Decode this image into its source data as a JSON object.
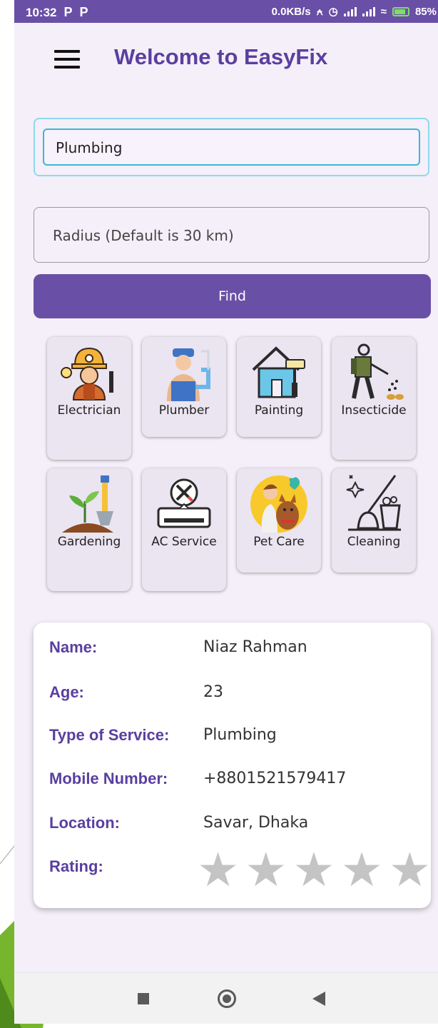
{
  "status_bar": {
    "time": "10:32",
    "notif_icons": [
      "P",
      "P"
    ],
    "net_speed": "0.0KB/s",
    "battery": "85%"
  },
  "header": {
    "title": "Welcome to EasyFix",
    "menu_icon": "hamburger-menu-icon"
  },
  "search": {
    "service_value": "Plumbing",
    "radius_placeholder": "Radius (Default is 30 km)",
    "find_label": "Find"
  },
  "services": [
    {
      "label": "Electrician",
      "icon": "electrician-icon"
    },
    {
      "label": "Plumber",
      "icon": "plumber-icon"
    },
    {
      "label": "Painting",
      "icon": "painting-icon"
    },
    {
      "label": "Insecticide",
      "icon": "insecticide-icon"
    },
    {
      "label": "Gardening",
      "icon": "gardening-icon"
    },
    {
      "label": "AC Service",
      "icon": "ac-service-icon"
    },
    {
      "label": "Pet Care",
      "icon": "pet-care-icon"
    },
    {
      "label": "Cleaning",
      "icon": "cleaning-icon"
    }
  ],
  "profile": {
    "name_label": "Name:",
    "name": "Niaz Rahman",
    "age_label": "Age:",
    "age": "23",
    "service_label": "Type of Service:",
    "service": "Plumbing",
    "mobile_label": "Mobile Number:",
    "mobile": "+8801521579417",
    "location_label": "Location:",
    "location": "Savar, Dhaka",
    "rating_label": "Rating:",
    "rating": 0,
    "rating_max": 5
  },
  "nav": {
    "recents": "recents-square-icon",
    "home": "home-circle-icon",
    "back": "back-triangle-icon"
  },
  "colors": {
    "primary": "#6a4fa6",
    "title": "#5a3fa0",
    "background": "#f4eff8",
    "tile": "#ebe4f1",
    "star_empty": "#c4c4c4",
    "focus": "#3fb4d8"
  }
}
